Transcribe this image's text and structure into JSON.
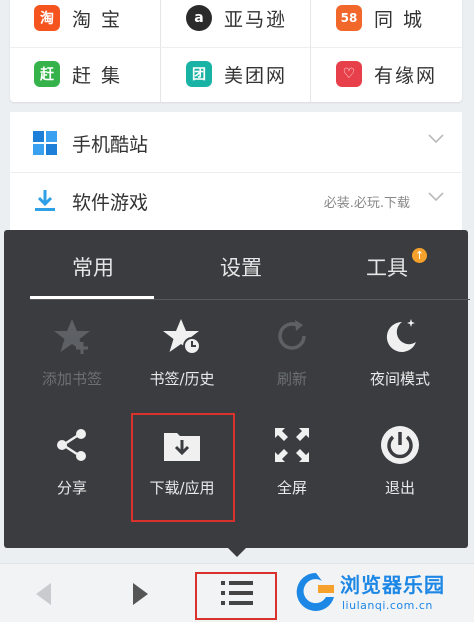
{
  "sites": [
    {
      "name": "淘 宝",
      "logo": "淘",
      "color": "#f5541e"
    },
    {
      "name": "亚马逊",
      "logo": "a",
      "color": "#2b2b2b"
    },
    {
      "name": "同 城",
      "logo": "58",
      "color": "#f2682a"
    },
    {
      "name": "赶 集",
      "logo": "赶",
      "color": "#35b34a"
    },
    {
      "name": "美团网",
      "logo": "团",
      "color": "#19b3a5"
    },
    {
      "name": "有缘网",
      "logo": "♡",
      "color": "#e8404a"
    }
  ],
  "list": {
    "mobile_sites": "手机酷站",
    "software_games": "软件游戏",
    "software_games_sub": "必装.必玩.下载"
  },
  "menu": {
    "tabs": [
      {
        "label": "常用"
      },
      {
        "label": "设置"
      },
      {
        "label": "工具"
      }
    ],
    "items": [
      {
        "label": "添加书签",
        "icon": "star-add-icon"
      },
      {
        "label": "书签/历史",
        "icon": "star-clock-icon"
      },
      {
        "label": "刷新",
        "icon": "refresh-icon"
      },
      {
        "label": "夜间模式",
        "icon": "moon-icon"
      },
      {
        "label": "分享",
        "icon": "share-icon"
      },
      {
        "label": "下载/应用",
        "icon": "download-folder-icon"
      },
      {
        "label": "全屏",
        "icon": "fullscreen-icon"
      },
      {
        "label": "退出",
        "icon": "power-icon"
      }
    ]
  },
  "watermark": {
    "title": "浏览器乐园",
    "url": "liulanqi.com.cn"
  },
  "colors": {
    "menu_bg": "#3a3c40",
    "highlight": "#d9312b",
    "badge": "#f5a12c",
    "brand_blue": "#1d87e6"
  }
}
